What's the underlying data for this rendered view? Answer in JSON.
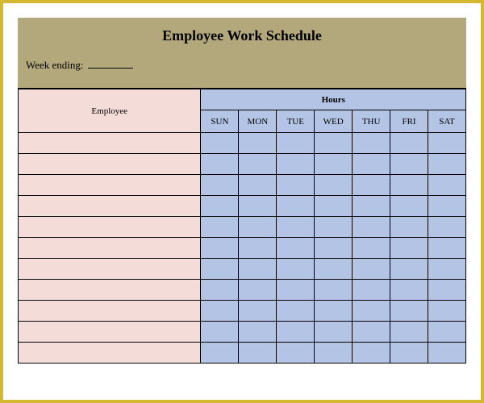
{
  "title": "Employee Work Schedule",
  "weekEndingLabel": "Week ending:",
  "weekEndingValue": "",
  "hoursHeader": "Hours",
  "employeeHeader": "Employee",
  "days": [
    "SUN",
    "MON",
    "TUE",
    "WED",
    "THU",
    "FRI",
    "SAT"
  ],
  "rows": [
    {
      "employee": "",
      "hours": [
        "",
        "",
        "",
        "",
        "",
        "",
        ""
      ]
    },
    {
      "employee": "",
      "hours": [
        "",
        "",
        "",
        "",
        "",
        "",
        ""
      ]
    },
    {
      "employee": "",
      "hours": [
        "",
        "",
        "",
        "",
        "",
        "",
        ""
      ]
    },
    {
      "employee": "",
      "hours": [
        "",
        "",
        "",
        "",
        "",
        "",
        ""
      ]
    },
    {
      "employee": "",
      "hours": [
        "",
        "",
        "",
        "",
        "",
        "",
        ""
      ]
    },
    {
      "employee": "",
      "hours": [
        "",
        "",
        "",
        "",
        "",
        "",
        ""
      ]
    },
    {
      "employee": "",
      "hours": [
        "",
        "",
        "",
        "",
        "",
        "",
        ""
      ]
    },
    {
      "employee": "",
      "hours": [
        "",
        "",
        "",
        "",
        "",
        "",
        ""
      ]
    },
    {
      "employee": "",
      "hours": [
        "",
        "",
        "",
        "",
        "",
        "",
        ""
      ]
    },
    {
      "employee": "",
      "hours": [
        "",
        "",
        "",
        "",
        "",
        "",
        ""
      ]
    },
    {
      "employee": "",
      "hours": [
        "",
        "",
        "",
        "",
        "",
        "",
        ""
      ]
    }
  ]
}
